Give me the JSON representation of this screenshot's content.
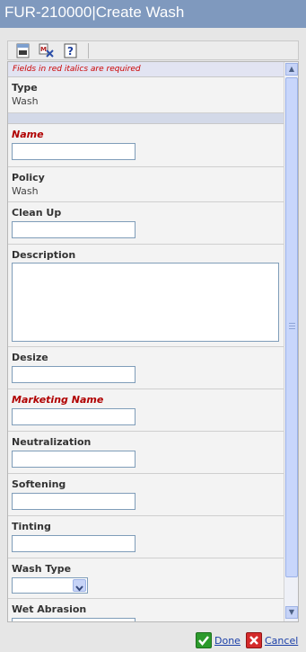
{
  "window": {
    "title": "FUR-210000|Create Wash"
  },
  "toolbar": {
    "buttons": [
      {
        "icon": "url-icon"
      },
      {
        "icon": "clear-fields-icon"
      },
      {
        "icon": "help-icon"
      }
    ]
  },
  "form": {
    "required_note": "Fields in red italics are required",
    "type": {
      "label": "Type",
      "value": "Wash"
    },
    "name": {
      "label": "Name",
      "value": ""
    },
    "policy": {
      "label": "Policy",
      "value": "Wash"
    },
    "clean_up": {
      "label": "Clean Up",
      "value": ""
    },
    "description": {
      "label": "Description",
      "value": ""
    },
    "desize": {
      "label": "Desize",
      "value": ""
    },
    "marketing_name": {
      "label": "Marketing Name",
      "value": ""
    },
    "neutralization": {
      "label": "Neutralization",
      "value": ""
    },
    "softening": {
      "label": "Softening",
      "value": ""
    },
    "tinting": {
      "label": "Tinting",
      "value": ""
    },
    "wash_type": {
      "label": "Wash Type",
      "value": ""
    },
    "wet_abrasion": {
      "label": "Wet Abrasion",
      "value": ""
    }
  },
  "footer": {
    "done_label": "Done",
    "cancel_label": "Cancel"
  },
  "colors": {
    "title_bar": "#7f99be",
    "required": "#b00000",
    "link": "#1a3fa8"
  }
}
